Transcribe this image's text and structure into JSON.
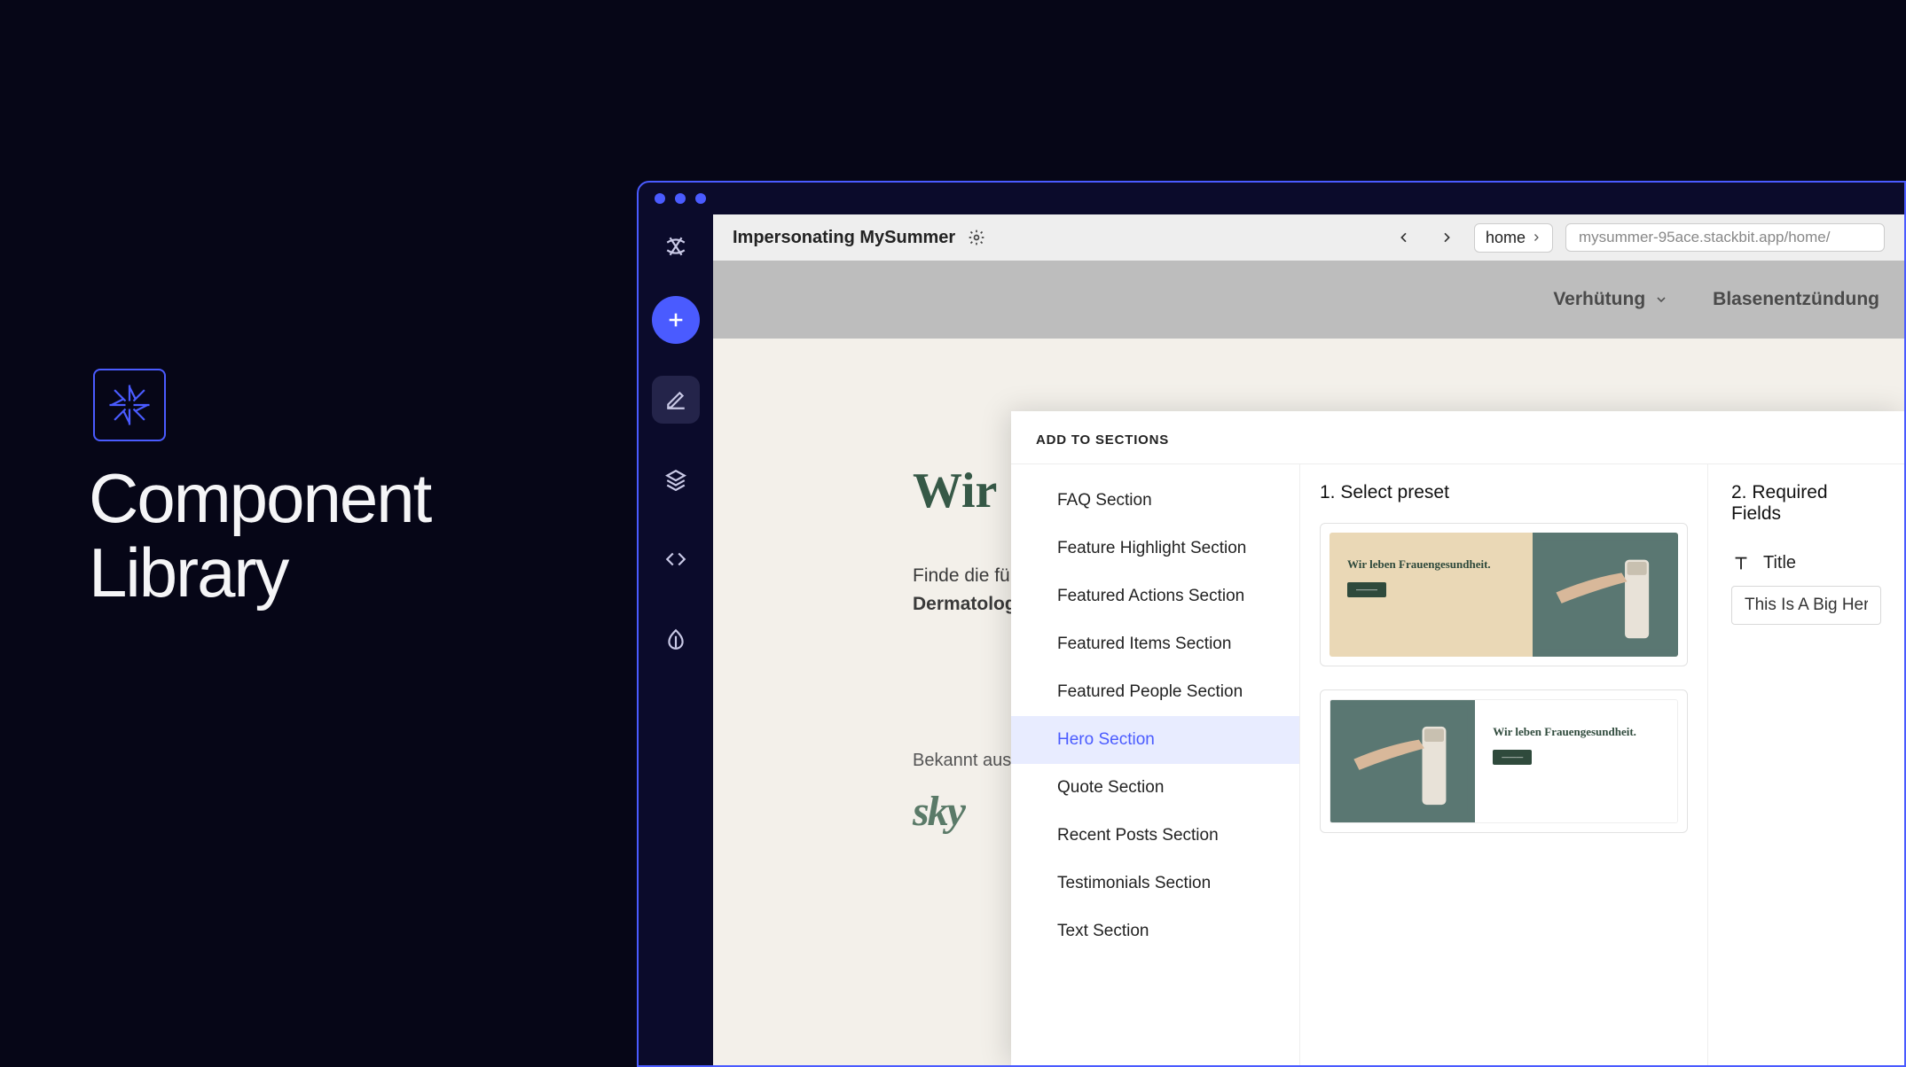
{
  "promo": {
    "title_line1": "Component",
    "title_line2": "Library"
  },
  "topbar": {
    "impersonating": "Impersonating MySummer",
    "crumb": "home",
    "url": "mysummer-95ace.stackbit.app/home/"
  },
  "site_nav": {
    "item1": "Verhütung",
    "item2": "Blasenentzündung"
  },
  "site": {
    "hero_prefix": "Wir",
    "body_line1": "Finde die für",
    "body_line2": "Dermatologi",
    "known_from": "Bekannt aus",
    "brand_logo": "sky"
  },
  "modal": {
    "header": "ADD TO SECTIONS",
    "sections": [
      {
        "label": "FAQ Section",
        "active": false
      },
      {
        "label": "Feature Highlight Section",
        "active": false
      },
      {
        "label": "Featured Actions Section",
        "active": false
      },
      {
        "label": "Featured Items Section",
        "active": false
      },
      {
        "label": "Featured People Section",
        "active": false
      },
      {
        "label": "Hero Section",
        "active": true
      },
      {
        "label": "Quote Section",
        "active": false
      },
      {
        "label": "Recent Posts Section",
        "active": false
      },
      {
        "label": "Testimonials Section",
        "active": false
      },
      {
        "label": "Text Section",
        "active": false
      }
    ],
    "presets": {
      "title": "1. Select preset",
      "cards": [
        {
          "headline": "Wir leben Frauengesundheit.",
          "layout": "text-left"
        },
        {
          "headline": "Wir leben Frauengesundheit.",
          "layout": "text-right"
        }
      ]
    },
    "required": {
      "title": "2. Required Fields",
      "title_field_label": "Title",
      "title_field_value": "This Is A Big Hero H"
    }
  }
}
